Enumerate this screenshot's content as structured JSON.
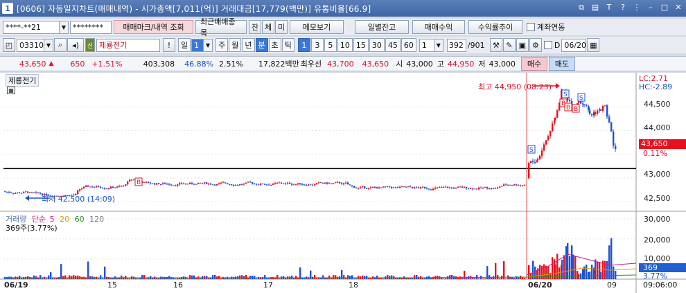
{
  "window": {
    "number": "1",
    "title": "[0606] 자동일지차트(매매내역) - 시가총액[7,011(억)] 거래대금[17,779(백만)] 유통비율[66.9]"
  },
  "toolbar1": {
    "account": "****-**21",
    "password": "********",
    "btn_trade_mark": "매매마크/내역 조회",
    "btn_recent": "최근매매종목",
    "btn_jan": "잔",
    "btn_che": "체",
    "btn_mi": "미",
    "btn_memo": "메모보기",
    "btn_daily": "일별잔고",
    "btn_profit": "매매수익",
    "btn_return": "수익률추이",
    "link_label": "계좌연동"
  },
  "toolbar2": {
    "code": "033100",
    "stock_name": "제룡전기",
    "period_value": "1",
    "period_tabs": [
      "일",
      "주",
      "월",
      "년",
      "분",
      "초",
      "틱"
    ],
    "selected_period": "분",
    "intervals": [
      "1",
      "3",
      "5",
      "10",
      "15",
      "30",
      "45",
      "60"
    ],
    "selected_interval": "1",
    "interval_value": "1",
    "count": "392",
    "count_total": "/901",
    "d_label": "D",
    "date": "06/20"
  },
  "quote": {
    "price": "43,650",
    "arrow": "▲",
    "change": "650",
    "change_pct": "+1.51%",
    "volume": "403,308",
    "vol_ratio": "46.88%",
    "turnover": "2.51%",
    "amount": "17,822백만",
    "best_label": "최우선",
    "best_ask": "43,700",
    "best_bid": "43,650",
    "open_label": "시",
    "open": "43,000",
    "high_label": "고",
    "high": "44,950",
    "low_label": "저",
    "low": "43,000",
    "buy_btn": "매수",
    "sell_btn": "매도"
  },
  "chart": {
    "stock_label": "제룡전기",
    "lc": "LC:2.71",
    "hc": "HC:-2.89",
    "high_annot": "최고 44,950 (08:23)",
    "low_annot": "최저 42,500 (14:09)",
    "price_box": "43,650",
    "pct_box": "0.11%",
    "y_ticks": [
      "44,500",
      "44,000",
      "43,500",
      "43,000",
      "42,500"
    ],
    "vol_legend": {
      "label": "거래량",
      "ma": "단순",
      "p5": "5",
      "p20": "20",
      "p60": "60",
      "p120": "120"
    },
    "vol_info": "369주(3.77%)",
    "vol_ticks": [
      "30,000",
      "20,000",
      "10,000"
    ],
    "vol_box": "369",
    "vol_pct": "3.77%",
    "x_ticks": [
      "06/19",
      "15",
      "16",
      "17",
      "18",
      "06/20",
      "09"
    ],
    "time_label": "09:06:00",
    "colors": {
      "up": "#e8101e",
      "down": "#1f4fd6",
      "line": "#000000",
      "vline": "#e05050"
    }
  },
  "chart_data": {
    "type": "candlestick",
    "price_range": [
      42300,
      45150
    ],
    "reference_line": 43200,
    "segments": [
      {
        "date": "06/19",
        "range": [
          42500,
          43050
        ]
      },
      {
        "date": "06/20",
        "range": [
          43000,
          44950
        ]
      }
    ],
    "volume_range": [
      0,
      32000
    ]
  }
}
